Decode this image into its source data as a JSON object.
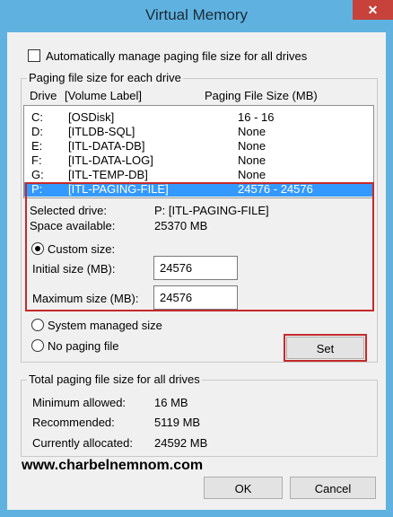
{
  "window": {
    "title": "Virtual Memory",
    "close_glyph": "✕"
  },
  "auto_manage": {
    "label": "Automatically manage paging file size for all drives",
    "checked": false
  },
  "paging_group": {
    "legend": "Paging file size for each drive",
    "col_drive": "Drive",
    "col_label": "[Volume Label]",
    "col_size": "Paging File Size (MB)",
    "drives": [
      {
        "drive": "C:",
        "label": "[OSDisk]",
        "size": "16 - 16"
      },
      {
        "drive": "D:",
        "label": "[ITLDB-SQL]",
        "size": "None"
      },
      {
        "drive": "E:",
        "label": "[ITL-DATA-DB]",
        "size": "None"
      },
      {
        "drive": "F:",
        "label": "[ITL-DATA-LOG]",
        "size": "None"
      },
      {
        "drive": "G:",
        "label": "[ITL-TEMP-DB]",
        "size": "None"
      },
      {
        "drive": "P:",
        "label": "[ITL-PAGING-FILE]",
        "size": "24576 - 24576"
      }
    ],
    "selected_drive_label": "Selected drive:",
    "selected_drive_value": "P:  [ITL-PAGING-FILE]",
    "space_label": "Space available:",
    "space_value": "25370 MB",
    "custom_size_label": "Custom size:",
    "initial_label": "Initial size (MB):",
    "initial_value": "24576",
    "max_label": "Maximum size (MB):",
    "max_value": "24576",
    "system_managed_label": "System managed size",
    "no_paging_label": "No paging file",
    "set_label": "Set"
  },
  "total_group": {
    "legend": "Total paging file size for all drives",
    "min_label": "Minimum allowed:",
    "min_value": "16 MB",
    "rec_label": "Recommended:",
    "rec_value": "5119 MB",
    "cur_label": "Currently allocated:",
    "cur_value": "24592 MB"
  },
  "watermark": "www.charbelnemnom.com",
  "footer": {
    "ok_label": "OK",
    "cancel_label": "Cancel"
  }
}
